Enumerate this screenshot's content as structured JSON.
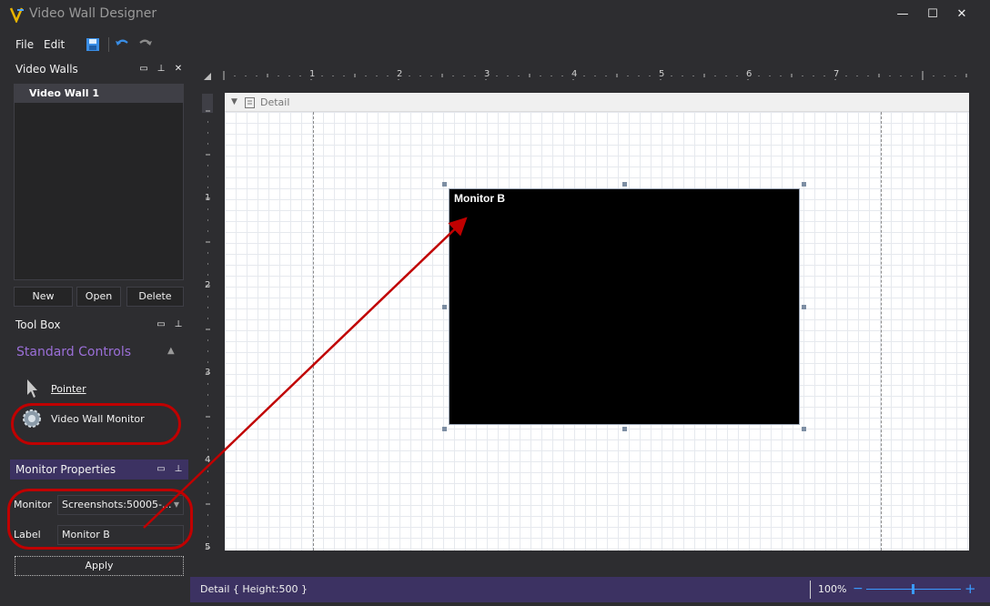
{
  "window": {
    "title": "Video Wall Designer",
    "minimize": "—",
    "maximize": "☐",
    "close": "✕"
  },
  "menu": {
    "file": "File",
    "edit": "Edit"
  },
  "toolbar": {
    "icons": [
      "save-icon",
      "undo-icon",
      "redo-icon"
    ]
  },
  "video_walls": {
    "header": "Video Walls",
    "items": [
      "Video Wall 1"
    ],
    "buttons": {
      "new": "New",
      "open": "Open",
      "delete": "Delete"
    }
  },
  "toolbox": {
    "header": "Tool Box",
    "group": "Standard Controls",
    "items": {
      "pointer": "Pointer",
      "monitor": "Video Wall Monitor"
    }
  },
  "monitor_properties": {
    "header": "Monitor Properties",
    "monitor_label": "Monitor",
    "monitor_value": "Screenshots:50005-...",
    "label_label": "Label",
    "label_value": "Monitor B",
    "apply": "Apply"
  },
  "ruler": {
    "h_labels": [
      "1",
      "2",
      "3",
      "4",
      "5",
      "6",
      "7"
    ],
    "v_labels": [
      "1",
      "2",
      "3",
      "4",
      "5"
    ]
  },
  "design": {
    "band": "Detail",
    "monitor_title": "Monitor B"
  },
  "status": {
    "text": "Detail { Height:500 }",
    "zoom": "100%",
    "zoom_out": "−",
    "zoom_in": "+"
  },
  "colors": {
    "accent": "#3c3262",
    "group_title": "#9b6fd8",
    "annotation": "#c00000"
  }
}
